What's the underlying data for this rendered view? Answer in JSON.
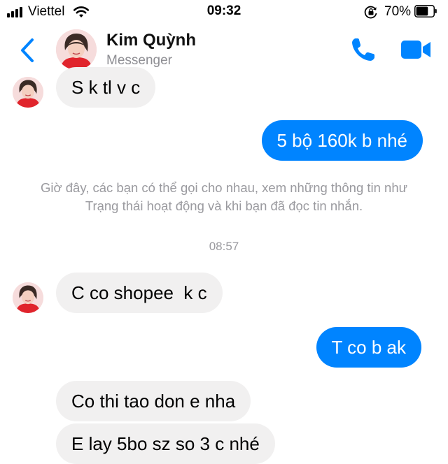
{
  "status_bar": {
    "carrier": "Viettel",
    "time": "09:32",
    "battery_percent": "70%",
    "battery_level": 0.7,
    "icons": [
      "signal-icon",
      "wifi-icon",
      "rotation-lock-icon",
      "battery-icon"
    ]
  },
  "header": {
    "contact_name": "Kim Quỳnh",
    "subtitle": "Messenger",
    "icons": [
      "back-chevron-icon",
      "phone-icon",
      "video-camera-icon"
    ],
    "accent_color": "#0084ff"
  },
  "messages": [
    {
      "direction": "in",
      "text": "S k tl v c"
    },
    {
      "direction": "out",
      "text": "5 bộ 160k b nhé"
    }
  ],
  "system_note": "Giờ đây, các bạn có thể gọi cho nhau, xem những thông tin như Trạng thái hoạt động và khi bạn đã đọc tin nhắn.",
  "timestamp": "08:57",
  "messages_after": [
    {
      "direction": "in",
      "text": "C co shopee  k c"
    },
    {
      "direction": "out",
      "text": "T co b ak"
    },
    {
      "direction": "in",
      "text": "Co thi tao don e nha"
    },
    {
      "direction": "in",
      "text": "E lay 5bo sz so 3 c nhé"
    }
  ],
  "colors": {
    "incoming_bubble": "#f1f0f0",
    "outgoing_bubble": "#0084ff",
    "meta_text": "#9a9a9f"
  }
}
